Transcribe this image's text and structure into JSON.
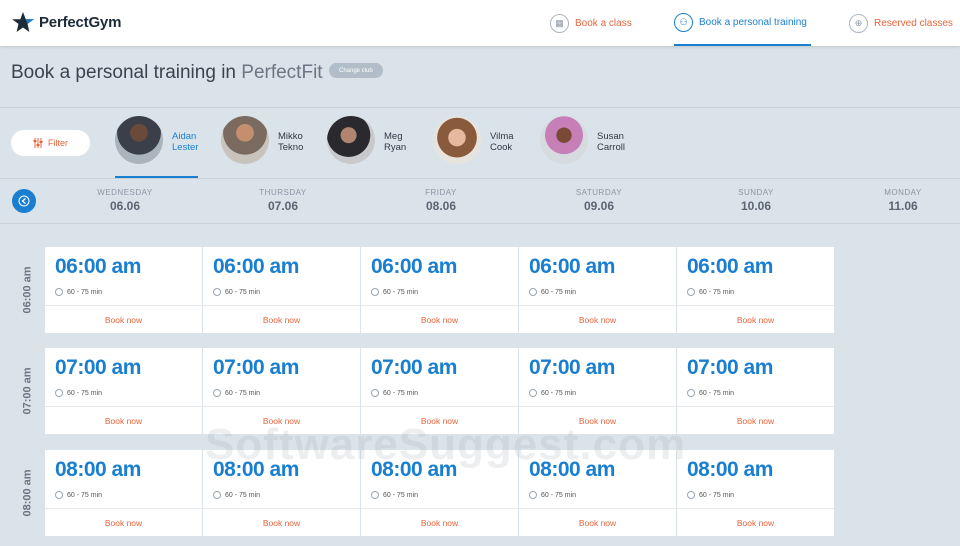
{
  "brand": {
    "name": "PerfectGym"
  },
  "nav": [
    {
      "label": "Book a class",
      "icon": "calendar-icon"
    },
    {
      "label": "Book a personal training",
      "icon": "trainer-icon"
    },
    {
      "label": "Reserved classes",
      "icon": "reserved-icon"
    }
  ],
  "header": {
    "title": "Book a personal training in",
    "club": "PerfectFit",
    "change_club_label": "Change club"
  },
  "filter": {
    "label": "Filter"
  },
  "trainers": [
    {
      "first": "Aidan",
      "last": "Lester",
      "active": true
    },
    {
      "first": "Mikko",
      "last": "Tekno",
      "active": false
    },
    {
      "first": "Meg",
      "last": "Ryan",
      "active": false
    },
    {
      "first": "Vilma",
      "last": "Cook",
      "active": false
    },
    {
      "first": "Susan",
      "last": "Carroll",
      "active": false
    }
  ],
  "days": [
    {
      "name": "WEDNESDAY",
      "date": "06.06"
    },
    {
      "name": "THURSDAY",
      "date": "07.06"
    },
    {
      "name": "FRIDAY",
      "date": "08.06"
    },
    {
      "name": "SATURDAY",
      "date": "09.06"
    },
    {
      "name": "SUNDAY",
      "date": "10.06"
    },
    {
      "name": "MONDAY",
      "date": "11.06"
    }
  ],
  "slots": [
    {
      "label": "06:00 am",
      "time": "06:00 am",
      "duration": "60 - 75 min",
      "book": "Book now"
    },
    {
      "label": "07:00 am",
      "time": "07:00 am",
      "duration": "60 - 75 min",
      "book": "Book now"
    },
    {
      "label": "08:00 am",
      "time": "08:00 am",
      "duration": "60 - 75 min",
      "book": "Book now"
    }
  ],
  "watermark": "SoftwareSuggest.com",
  "colors": {
    "accent": "#1a7fd1",
    "link": "#e8643c",
    "background": "#dbe3ea"
  }
}
